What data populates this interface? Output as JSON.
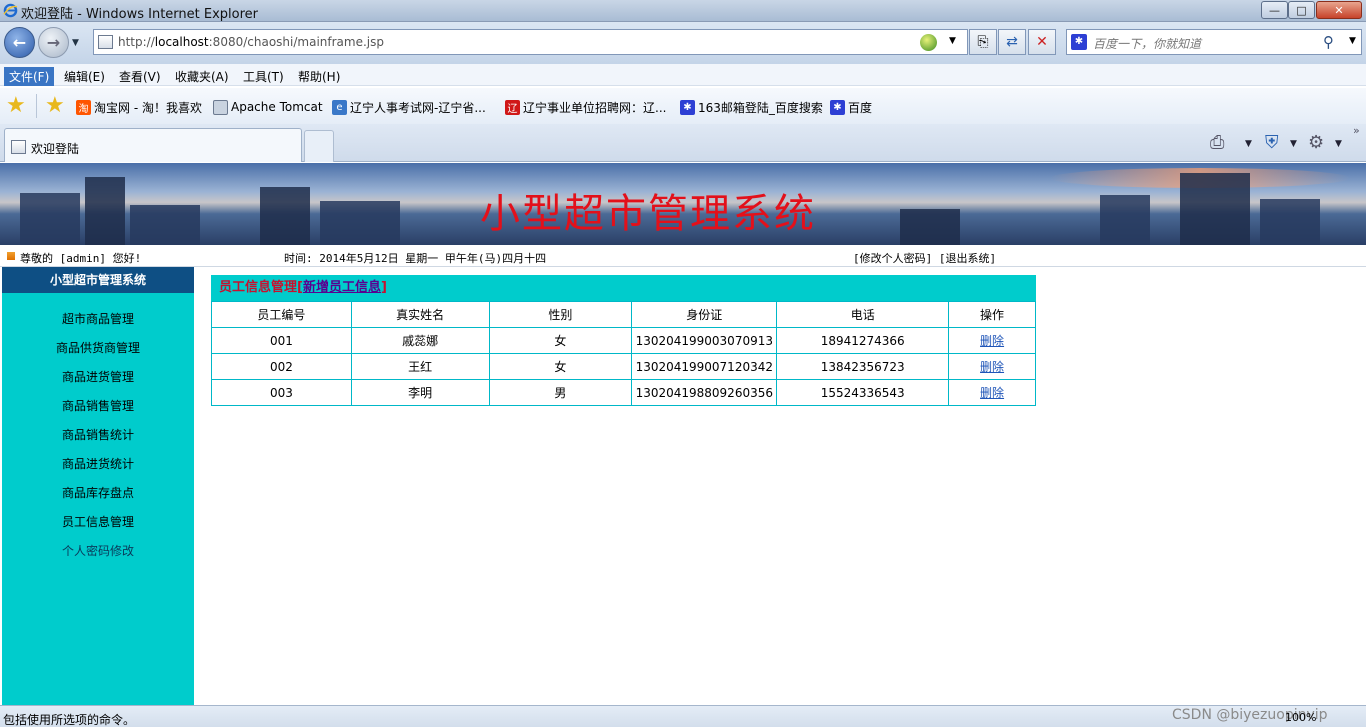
{
  "window": {
    "title": "欢迎登陆 - Windows Internet Explorer",
    "min_glyph": "—",
    "max_glyph": "□",
    "close_glyph": "✕"
  },
  "addressbar": {
    "url_prefix": "http://",
    "url_host": "localhost",
    "url_rest": ":8080/chaoshi/mainframe.jsp",
    "search_placeholder": "百度一下，你就知道"
  },
  "menu": [
    "文件(F)",
    "编辑(E)",
    "查看(V)",
    "收藏夹(A)",
    "工具(T)",
    "帮助(H)"
  ],
  "favorites": [
    {
      "label": "淘宝网 - 淘！我喜欢",
      "icon": "taobao-icon",
      "color": "#ff5500"
    },
    {
      "label": "Apache Tomcat",
      "icon": "page-icon",
      "color": "#6c7a90"
    },
    {
      "label": "辽宁人事考试网-辽宁省...",
      "icon": "ie-page-icon",
      "color": "#3a78c8"
    },
    {
      "label": "辽宁事业单位招聘网：辽...",
      "icon": "zhaopin-icon",
      "color": "#d01818"
    },
    {
      "label": "163邮箱登陆_百度搜索",
      "icon": "baidu-paw-icon",
      "color": "#2d3fd4"
    },
    {
      "label": "百度",
      "icon": "baidu-paw-icon",
      "color": "#2d3fd4"
    }
  ],
  "tab": {
    "label": "欢迎登陆"
  },
  "page": {
    "banner_title": "小型超市管理系统",
    "greeting": "尊敬的 [admin] 您好!",
    "time_text": "时间:  2014年5月12日 星期一 甲午年(马)四月十四",
    "user_links": "[修改个人密码] [退出系统]"
  },
  "sidebar": {
    "title": "小型超市管理系统",
    "items": [
      "超市商品管理",
      "商品供货商管理",
      "商品进货管理",
      "商品销售管理",
      "商品销售统计",
      "商品进货统计",
      "商品库存盘点",
      "员工信息管理",
      "个人密码修改"
    ]
  },
  "content": {
    "section_title": "员工信息管理",
    "add_link": "新增员工信息",
    "columns": [
      "员工编号",
      "真实姓名",
      "性别",
      "身份证",
      "电话",
      "操作"
    ],
    "rows": [
      {
        "id": "001",
        "name": "戚蕊娜",
        "gender": "女",
        "id_card": "130204199003070913",
        "phone": "18941274366",
        "action": "删除"
      },
      {
        "id": "002",
        "name": "王红",
        "gender": "女",
        "id_card": "130204199007120342",
        "phone": "13842356723",
        "action": "删除"
      },
      {
        "id": "003",
        "name": "李明",
        "gender": "男",
        "id_card": "130204198809260356",
        "phone": "15524336543",
        "action": "删除"
      }
    ]
  },
  "status": {
    "message": "包括使用所选项的命令。",
    "watermark": "CSDN @biyezuopinvip",
    "zoom": "100%"
  },
  "colors": {
    "banner_title": "#e3101a",
    "sidebar_bg": "#00cccc",
    "sidebar_head": "#0e4f84",
    "table_border": "#00b8c8"
  }
}
